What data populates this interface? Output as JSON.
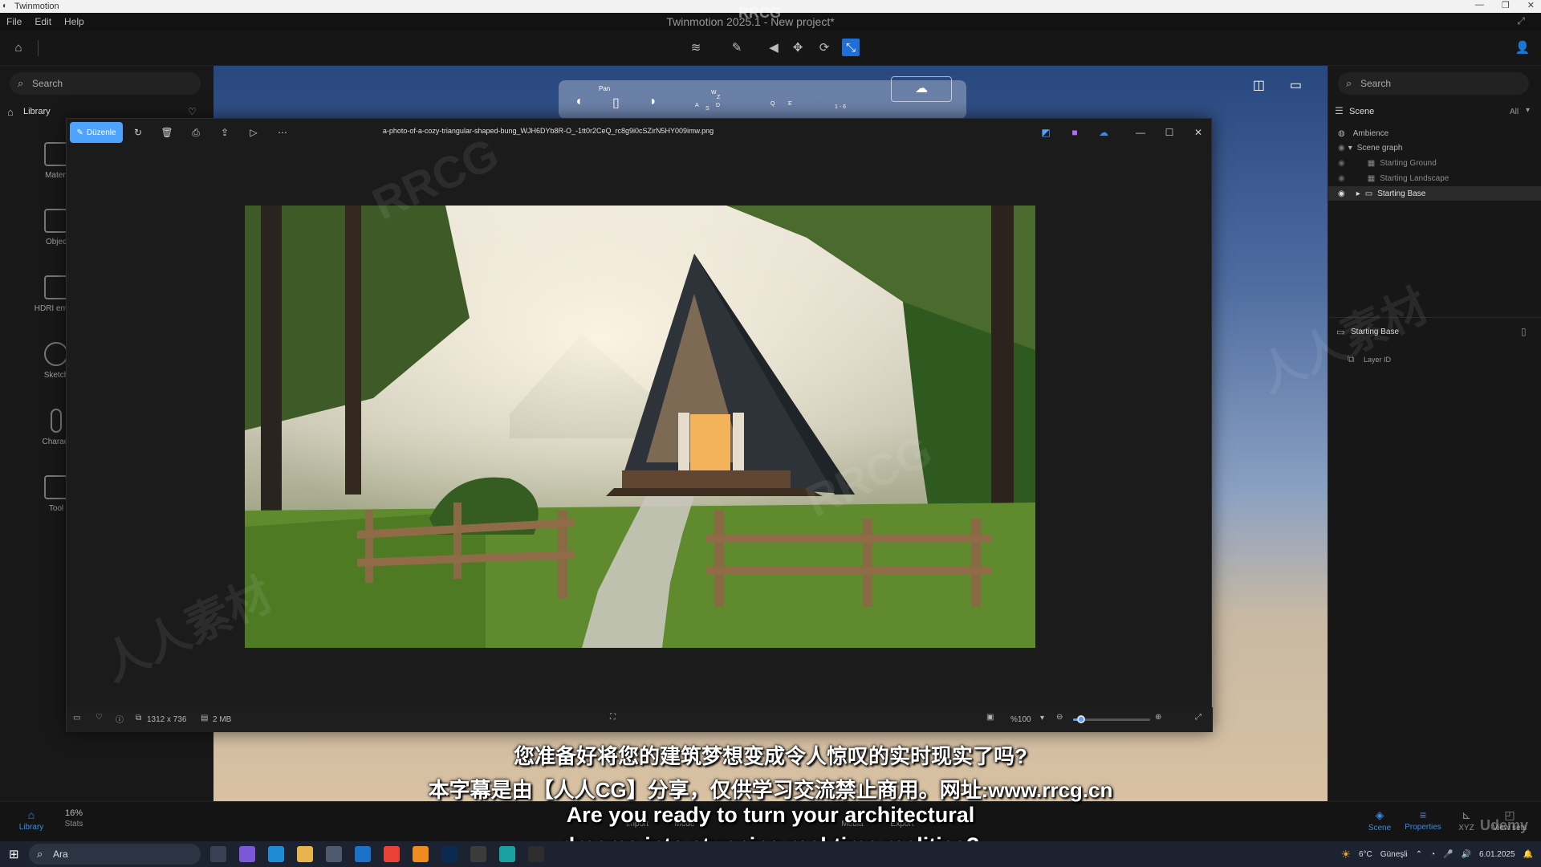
{
  "os_window": {
    "app_name": "Twinmotion"
  },
  "menu": {
    "items": [
      "File",
      "Edit",
      "Help"
    ],
    "title": "Twinmotion 2025.1 - New project*"
  },
  "left_sidebar": {
    "search_placeholder": "Search",
    "library_label": "Library",
    "items": [
      "Materi",
      "Objec",
      "HDRI enviro",
      "Sketch",
      "Charact",
      "Tool"
    ]
  },
  "nav_bar": {
    "pan_label": "Pan",
    "keys": [
      "W",
      "Z",
      "A",
      "S",
      "D",
      "Q",
      "E",
      "1 - 6"
    ]
  },
  "right_panel": {
    "search_placeholder": "Search",
    "scene_label": "Scene",
    "filter_label": "All",
    "tree": [
      {
        "label": "Ambience"
      },
      {
        "label": "Scene graph"
      },
      {
        "label": "Starting Ground"
      },
      {
        "label": "Starting Landscape"
      },
      {
        "label": "Starting Base"
      }
    ],
    "properties_title": "Starting Base",
    "layer_label": "Layer ID"
  },
  "viewer": {
    "edit_label": "Düzenle",
    "filename": "a-photo-of-a-cozy-triangular-shaped-bung_WJH6DYb8R-O_-1tt0r2CeQ_rc8g9i0cSZirN5HY009imw.png",
    "dimensions": "1312 x 736",
    "filesize": "2 MB",
    "zoom": "%100",
    "zoom_level": 0.1
  },
  "bottom_bar": {
    "left_items": [
      {
        "label": "Library",
        "icon": "library-icon"
      },
      {
        "label": "Stats",
        "value": "16%"
      }
    ],
    "center_items": [
      "Import",
      "Mode",
      "Media",
      "Export"
    ],
    "right_items": [
      "Scene",
      "Properties",
      "XYZ",
      "View sets"
    ]
  },
  "subtitles": {
    "zh_line1": "您准备好将您的建筑梦想变成令人惊叹的实时现实了吗?",
    "zh_line2": "本字幕是由【人人CG】分享，仅供学习交流禁止商用。网址:www.rrcg.cn",
    "en_line1": "Are you ready to turn your architectural",
    "en_line2": "dreams into stunning real-time realities?"
  },
  "watermark": {
    "brand": "RRCG",
    "cn": "人人素材",
    "udemy": "Udemy"
  },
  "taskbar": {
    "search_placeholder": "Ara",
    "weather": "6°C",
    "weather_label": "Güneşli",
    "date": "6.01.2025"
  },
  "colors": {
    "accent": "#1e6fd8",
    "edit_button": "#4ea3ff",
    "sky_top": "#28477f",
    "ground": "#d9c1a2"
  }
}
